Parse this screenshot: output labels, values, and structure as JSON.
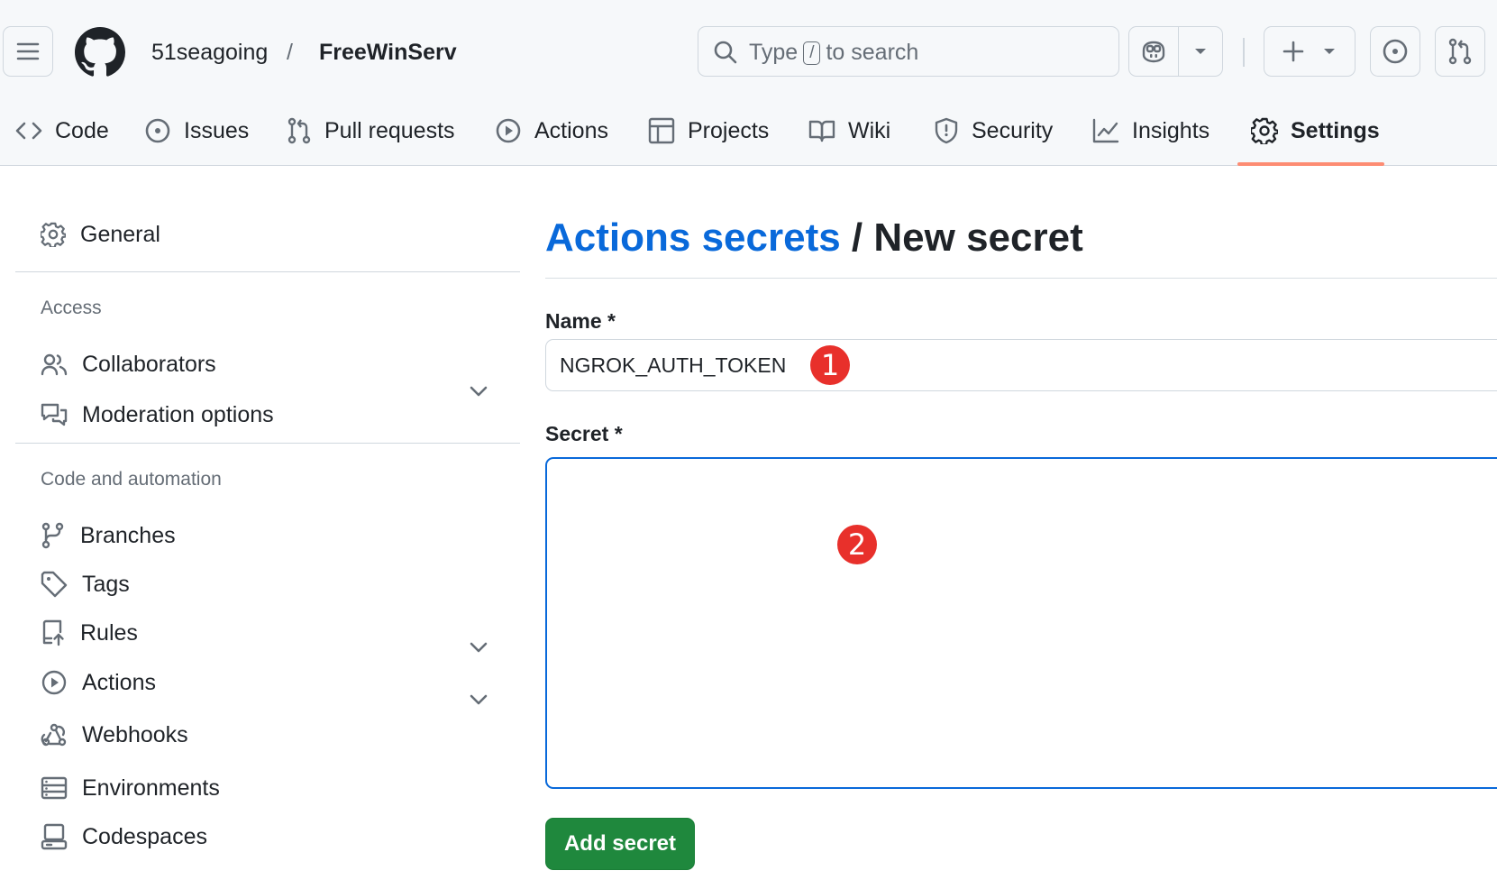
{
  "header": {
    "owner": "51seagoing",
    "separator": "/",
    "repo": "FreeWinServ",
    "search": {
      "prefix": "Type",
      "key": "/",
      "suffix": "to search"
    }
  },
  "tabs": [
    {
      "label": "Code",
      "icon": "code-icon"
    },
    {
      "label": "Issues",
      "icon": "issue-icon"
    },
    {
      "label": "Pull requests",
      "icon": "pull-request-icon"
    },
    {
      "label": "Actions",
      "icon": "play-icon"
    },
    {
      "label": "Projects",
      "icon": "table-icon"
    },
    {
      "label": "Wiki",
      "icon": "book-icon"
    },
    {
      "label": "Security",
      "icon": "shield-icon"
    },
    {
      "label": "Insights",
      "icon": "graph-icon"
    },
    {
      "label": "Settings",
      "icon": "gear-icon",
      "selected": true
    }
  ],
  "sidebar": {
    "general": "General",
    "access_heading": "Access",
    "access_items": [
      "Collaborators",
      "Moderation options"
    ],
    "code_heading": "Code and automation",
    "code_items": [
      "Branches",
      "Tags",
      "Rules",
      "Actions",
      "Webhooks",
      "Environments",
      "Codespaces"
    ]
  },
  "main": {
    "title_link": "Actions secrets",
    "title_rest": " / New secret",
    "name_label": "Name *",
    "name_value": "NGROK_AUTH_TOKEN",
    "secret_label": "Secret *",
    "secret_value": "",
    "submit_label": "Add secret"
  },
  "annotations": [
    "1",
    "2"
  ],
  "colors": {
    "accent": "#0969da",
    "primary_button": "#1f883d",
    "selected_tab_underline": "#fd8c73",
    "annotation_marker": "#e8302b"
  }
}
